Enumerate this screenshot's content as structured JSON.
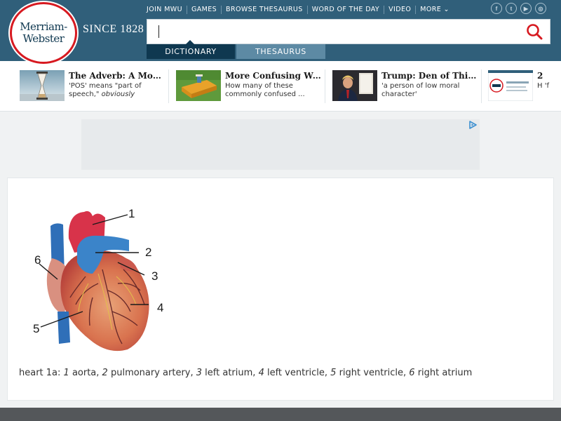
{
  "logo": {
    "line1": "Merriam-",
    "line2": "Webster"
  },
  "since": "SINCE 1828",
  "topnav": [
    "JOIN MWU",
    "GAMES",
    "BROWSE THESAURUS",
    "WORD OF THE DAY",
    "VIDEO",
    "MORE"
  ],
  "socials": {
    "facebook": "f",
    "twitter": "t",
    "youtube": "▶",
    "instagram": "◎"
  },
  "search": {
    "value": "",
    "placeholder": ""
  },
  "tabs": {
    "dictionary": "DICTIONARY",
    "thesaurus": "THESAURUS"
  },
  "stories": [
    {
      "title": "The Adverb: A Most ...",
      "sub_plain": "'POS' means \"part of speech,\" ",
      "sub_italic": "obviously"
    },
    {
      "title": "More Confusing Wo...",
      "sub": "How many of these commonly confused ..."
    },
    {
      "title": "Trump: Den of Thie...",
      "sub": "'a person of low moral character'"
    },
    {
      "title": "2",
      "sub": "H 'f"
    }
  ],
  "diagram": {
    "labels": [
      "1",
      "2",
      "3",
      "4",
      "5",
      "6"
    ],
    "caption": {
      "prefix": "heart 1a: ",
      "items": [
        {
          "n": "1",
          "t": " aorta, "
        },
        {
          "n": "2",
          "t": " pulmonary artery, "
        },
        {
          "n": "3",
          "t": " left atrium, "
        },
        {
          "n": "4",
          "t": " left ventricle, "
        },
        {
          "n": "5",
          "t": " right ventricle, "
        },
        {
          "n": "6",
          "t": " right atrium"
        }
      ]
    }
  },
  "colors": {
    "header": "#305f7a",
    "tab_active": "#0f3850",
    "tab_inactive": "#5d8aa4",
    "logo_ring": "#d71920",
    "search_icon": "#d71920"
  }
}
